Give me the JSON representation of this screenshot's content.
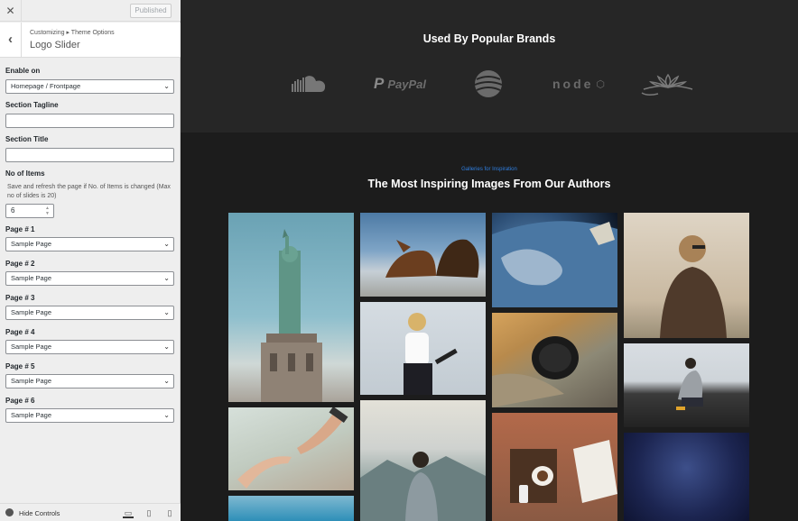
{
  "customizer": {
    "close_icon": "close-icon",
    "publish_label": "Published",
    "breadcrumb": "Customizing ▸ Theme Options",
    "section_title": "Logo Slider",
    "fields": {
      "enable_on_label": "Enable on",
      "enable_on_value": "Homepage / Frontpage",
      "tagline_label": "Section Tagline",
      "tagline_value": "",
      "title_label": "Section Title",
      "title_value": "",
      "items_label": "No of Items",
      "items_desc": "Save and refresh the page if No. of Items is changed (Max no of slides is 20)",
      "items_value": "6",
      "pages": [
        {
          "label": "Page # 1",
          "value": "Sample Page"
        },
        {
          "label": "Page # 2",
          "value": "Sample Page"
        },
        {
          "label": "Page # 3",
          "value": "Sample Page"
        },
        {
          "label": "Page # 4",
          "value": "Sample Page"
        },
        {
          "label": "Page # 5",
          "value": "Sample Page"
        },
        {
          "label": "Page # 6",
          "value": "Sample Page"
        }
      ]
    },
    "footer": {
      "hide_label": "Hide Controls"
    }
  },
  "preview": {
    "brands_title": "Used By Popular Brands",
    "paypal_text": "PayPal",
    "node_text": "node",
    "gallery_tagline": "Galleries for Inspiration",
    "gallery_title": "The Most Inspiring Images From Our Authors"
  },
  "colors": {
    "accent_blue": "#2f7ee0",
    "panel_bg": "#eeeeee",
    "preview_dark": "#1c1c1c",
    "brand_bar": "#262626"
  }
}
